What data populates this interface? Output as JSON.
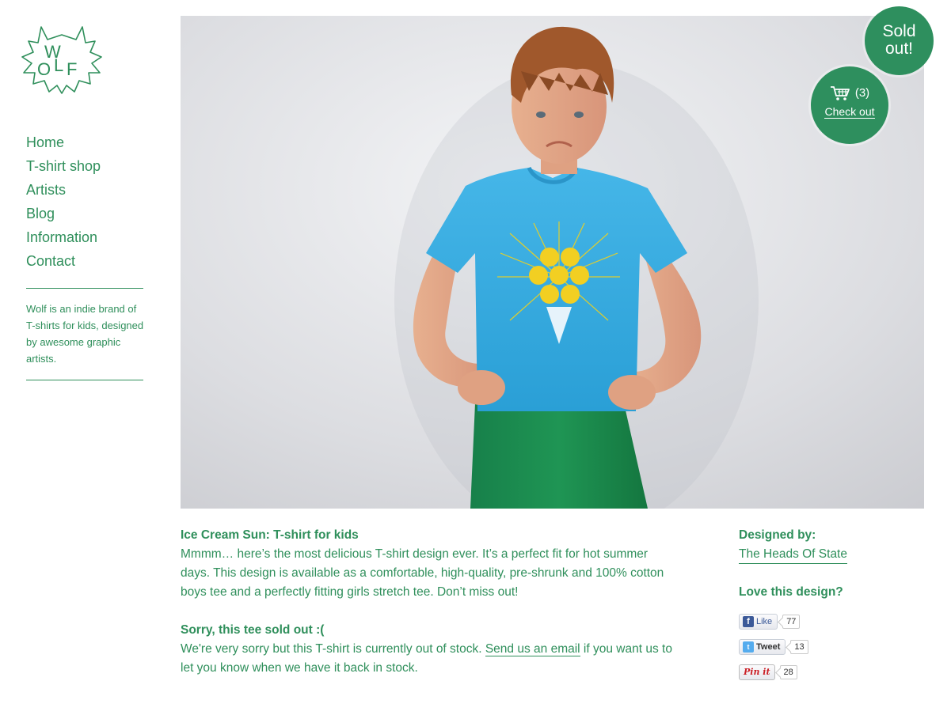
{
  "brand": {
    "logo_text": "WOLF"
  },
  "nav": {
    "items": [
      {
        "label": "Home"
      },
      {
        "label": "T-shirt shop"
      },
      {
        "label": "Artists"
      },
      {
        "label": "Blog"
      },
      {
        "label": "Information"
      },
      {
        "label": "Contact"
      }
    ]
  },
  "sidebar": {
    "tagline": "Wolf is an indie brand of T-shirts for kids, designed by awesome graphic artists."
  },
  "badges": {
    "sold_line1": "Sold",
    "sold_line2": "out!",
    "cart_count": "(3)",
    "checkout_label": "Check out",
    "cart_icon": "shopping-cart-icon"
  },
  "product": {
    "title": "Ice Cream Sun: T-shirt for kids",
    "description": "Mmmm… here’s the most delicious T-shirt design ever. It’s a perfect fit for hot summer days. This design is available as a comfortable, high-quality, pre-shrunk and 100% cotton boys tee and a perfectly fitting girls stretch tee. Don’t miss out!",
    "soldout_heading": "Sorry, this tee sold out :(",
    "soldout_text_before": "We're very sorry but this T-shirt is currently out of stock. ",
    "soldout_link": "Send us an email",
    "soldout_text_after": " if you want us to let you know when we have it back in stock."
  },
  "aside": {
    "designed_by_label": "Designed by:",
    "designer_name": "The Heads Of State",
    "love_label": "Love this design?",
    "like_label": "Like",
    "like_count": "77",
    "tweet_label": "Tweet",
    "tweet_count": "13",
    "pin_label": "Pin it",
    "pin_count": "28"
  },
  "colors": {
    "brand_green": "#2f8f5b",
    "shirt_blue": "#3aabe0",
    "pants_green": "#1e8c4c",
    "print_yellow": "#f2d21b"
  }
}
